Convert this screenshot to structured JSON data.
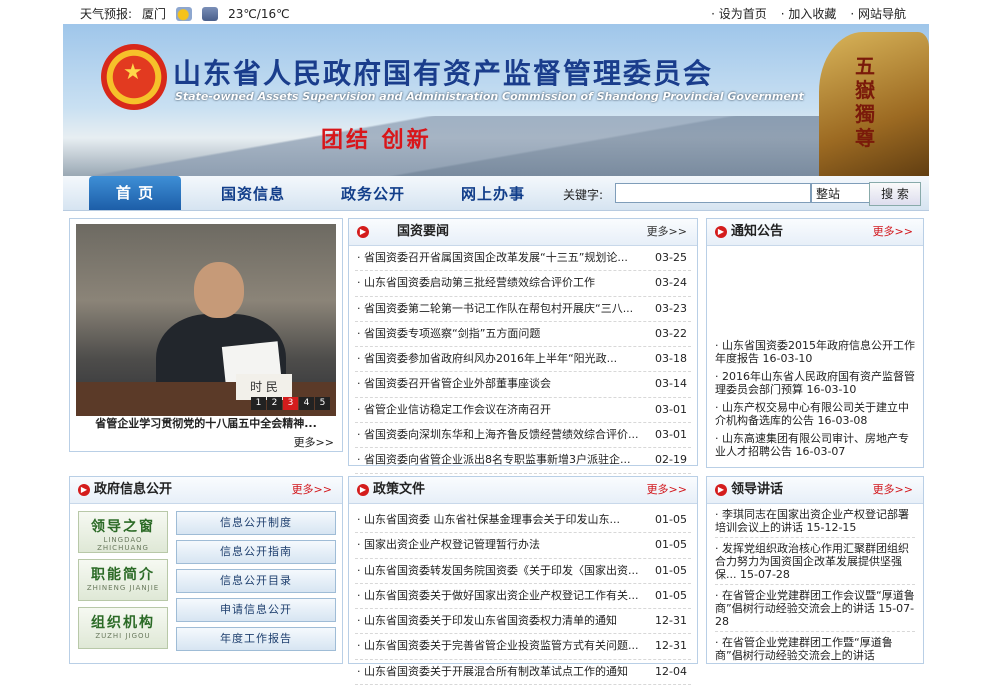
{
  "topbar": {
    "weather_label": "天气预报:",
    "city": "厦门",
    "weather_icons": [
      "sun-cloud-icon",
      "rain-cloud-icon"
    ],
    "temperature": "23℃/16℃",
    "links": [
      "· 设为首页",
      "· 加入收藏",
      "· 网站导航"
    ]
  },
  "banner": {
    "title": "山东省人民政府国有资产监督管理委员会",
    "subtitle": "State-owned Assets Supervision and Administration Commission of Shandong Provincial Government",
    "slogan": "团结  创新",
    "rock_text": "五嶽獨尊"
  },
  "nav": {
    "items": [
      "首  页",
      "国资信息",
      "政务公开",
      "网上办事"
    ],
    "search_label": "关键字:",
    "search_value": "",
    "scope": "整站",
    "search_button": "搜  索"
  },
  "photo": {
    "nameplate": "时 民",
    "pages": [
      "1",
      "2",
      "3",
      "4",
      "5"
    ],
    "active_page": "3",
    "caption": "省管企业学习贯彻党的十八届五中全会精神...",
    "more": "更多>>"
  },
  "news": {
    "title": "国资要闻",
    "more": "更多>>",
    "items": [
      {
        "t": "· 省国资委召开省属国资国企改革发展“十三五”规划论...",
        "d": "03-25"
      },
      {
        "t": "· 山东省国资委启动第三批经营绩效综合评价工作",
        "d": "03-24"
      },
      {
        "t": "· 省国资委第二轮第一书记工作队在帮包村开展庆“三八...",
        "d": "03-23"
      },
      {
        "t": "· 省国资委专项巡察“剑指”五方面问题",
        "d": "03-22"
      },
      {
        "t": "· 省国资委参加省政府纠风办2016年上半年“阳光政...",
        "d": "03-18"
      },
      {
        "t": "· 省国资委召开省管企业外部董事座谈会",
        "d": "03-14"
      },
      {
        "t": "· 省管企业信访稳定工作会议在济南召开",
        "d": "03-01"
      },
      {
        "t": "· 省国资委向深圳东华和上海齐鲁反馈经营绩效综合评价...",
        "d": "03-01"
      },
      {
        "t": "· 省国资委向省管企业派出8名专职监事新增3户派驻企...",
        "d": "02-19"
      }
    ]
  },
  "notice": {
    "title": "通知公告",
    "more": "更多>>",
    "items": [
      "· 山东省国资委2015年政府信息公开工作年度报告      16-03-10",
      "· 2016年山东省人民政府国有资产监督管理委员会部门预算      16-03-10",
      "· 山东产权交易中心有限公司关于建立中介机构备选库的公告      16-03-08",
      "· 山东高速集团有限公司审计、房地产专业人才招聘公告      16-03-07"
    ]
  },
  "gov_info": {
    "title": "政府信息公开",
    "more": "更多>>",
    "cards": [
      {
        "cn": "领导之窗",
        "py": "LINGDAO ZHICHUANG"
      },
      {
        "cn": "职能简介",
        "py": "ZHINENG JIANJIE"
      },
      {
        "cn": "组织机构",
        "py": "ZUZHI JIGOU"
      }
    ],
    "buttons": [
      "信息公开制度",
      "信息公开指南",
      "信息公开目录",
      "申请信息公开",
      "年度工作报告"
    ]
  },
  "policy": {
    "title": "政策文件",
    "more": "更多>>",
    "items": [
      {
        "t": "· 山东省国资委 山东省社保基金理事会关于印发山东...",
        "d": "01-05"
      },
      {
        "t": "· 国家出资企业产权登记管理暂行办法",
        "d": "01-05"
      },
      {
        "t": "· 山东省国资委转发国务院国资委《关于印发〈国家出资...",
        "d": "01-05"
      },
      {
        "t": "· 山东省国资委关于做好国家出资企业产权登记工作有关...",
        "d": "01-05"
      },
      {
        "t": "· 山东省国资委关于印发山东省国资委权力清单的通知",
        "d": "12-31"
      },
      {
        "t": "· 山东省国资委关于完善省管企业投资监管方式有关问题...",
        "d": "12-31"
      },
      {
        "t": "· 山东省国资委关于开展混合所有制改革试点工作的通知",
        "d": "12-04"
      }
    ]
  },
  "leader": {
    "title": "领导讲话",
    "more": "更多>>",
    "items": [
      "· 李琪同志在国家出资企业产权登记部署培训会议上的讲话      15-12-15",
      "· 发挥党组织政治核心作用汇聚群团组织合力努力为国资国企改革发展提供坚强保...      15-07-28",
      "· 在省管企业党建群团工作会议暨“厚道鲁商”倡树行动经验交流会上的讲话      15-07-28",
      "· 在省管企业党建群团工作暨“厚道鲁商”倡树行动经验交流会上的讲话"
    ]
  }
}
